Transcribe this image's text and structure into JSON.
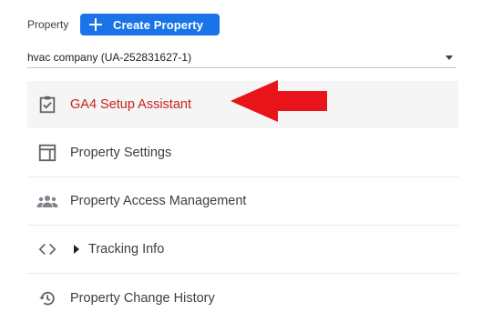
{
  "header": {
    "property_label": "Property",
    "create_button_label": "Create Property"
  },
  "property_selector": {
    "value": "hvac company (UA-252831627-1)"
  },
  "menu": {
    "items": [
      {
        "label": "GA4 Setup Assistant",
        "icon": "clipboard-check-icon",
        "active": true
      },
      {
        "label": "Property Settings",
        "icon": "window-layout-icon",
        "active": false
      },
      {
        "label": "Property Access Management",
        "icon": "people-group-icon",
        "active": false
      },
      {
        "label": "Tracking Info",
        "icon": "code-brackets-icon",
        "active": false
      },
      {
        "label": "Property Change History",
        "icon": "history-icon",
        "active": false
      }
    ]
  },
  "colors": {
    "accent": "#1a73e8",
    "active_text": "#c5221f",
    "annotation_arrow": "#e8141a"
  }
}
